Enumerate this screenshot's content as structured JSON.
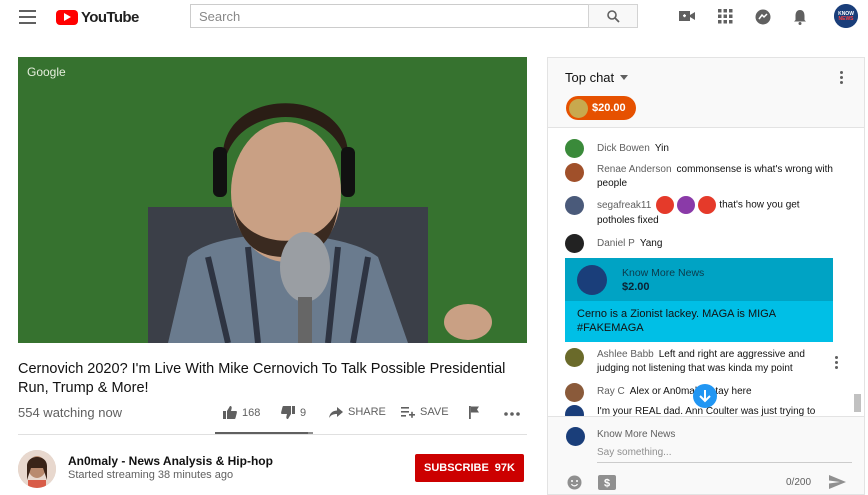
{
  "masthead": {
    "logo_text": "YouTube",
    "search_placeholder": "Search"
  },
  "video": {
    "watermark": "Google",
    "title": "Cernovich 2020? I'm Live With Mike Cernovich To Talk Possible Presidential Run, Trump & More!",
    "watching": "554 watching now",
    "likes": "168",
    "dislikes": "9",
    "share_label": "SHARE",
    "save_label": "SAVE",
    "like_ratio": 0.95
  },
  "channel": {
    "name": "An0maly - News Analysis & Hip-hop",
    "status": "Started streaming 38 minutes ago",
    "subscribe_label": "SUBSCRIBE",
    "subscriber_count": "97K"
  },
  "chat": {
    "mode_label": "Top chat",
    "ticker_amount": "$20.00",
    "messages": [
      {
        "author": "Dick Bowen",
        "text": "Yin",
        "color": "#3a8a3a"
      },
      {
        "author": "Renae Anderson",
        "text": "commonsense is what's wrong with people",
        "color": "#a0502a"
      },
      {
        "author": "segafreak11",
        "text": "that's how you get potholes fixed",
        "color": "#4a5a7a"
      },
      {
        "author": "Daniel P",
        "text": "Yang",
        "color": "#222222"
      },
      {
        "author": "Ashlee Babb",
        "text": "Left and right are aggressive and judging not listening that was kinda my point",
        "color": "#6a6a2a"
      },
      {
        "author": "Ray C",
        "text": "Alex or An0maly I stay here",
        "color": "#8a5a3a"
      },
      {
        "author": "",
        "text": "I'm your REAL dad. Ann Coulter was just trying to",
        "color": "#1a3e7a"
      }
    ],
    "superchat": {
      "author": "Know More News",
      "amount": "$2.00",
      "text": "Cerno is a Zionist lackey. MAGA is MIGA #FAKEMAGA"
    },
    "input": {
      "author": "Know More News",
      "placeholder": "Say something...",
      "counter": "0/200"
    }
  }
}
